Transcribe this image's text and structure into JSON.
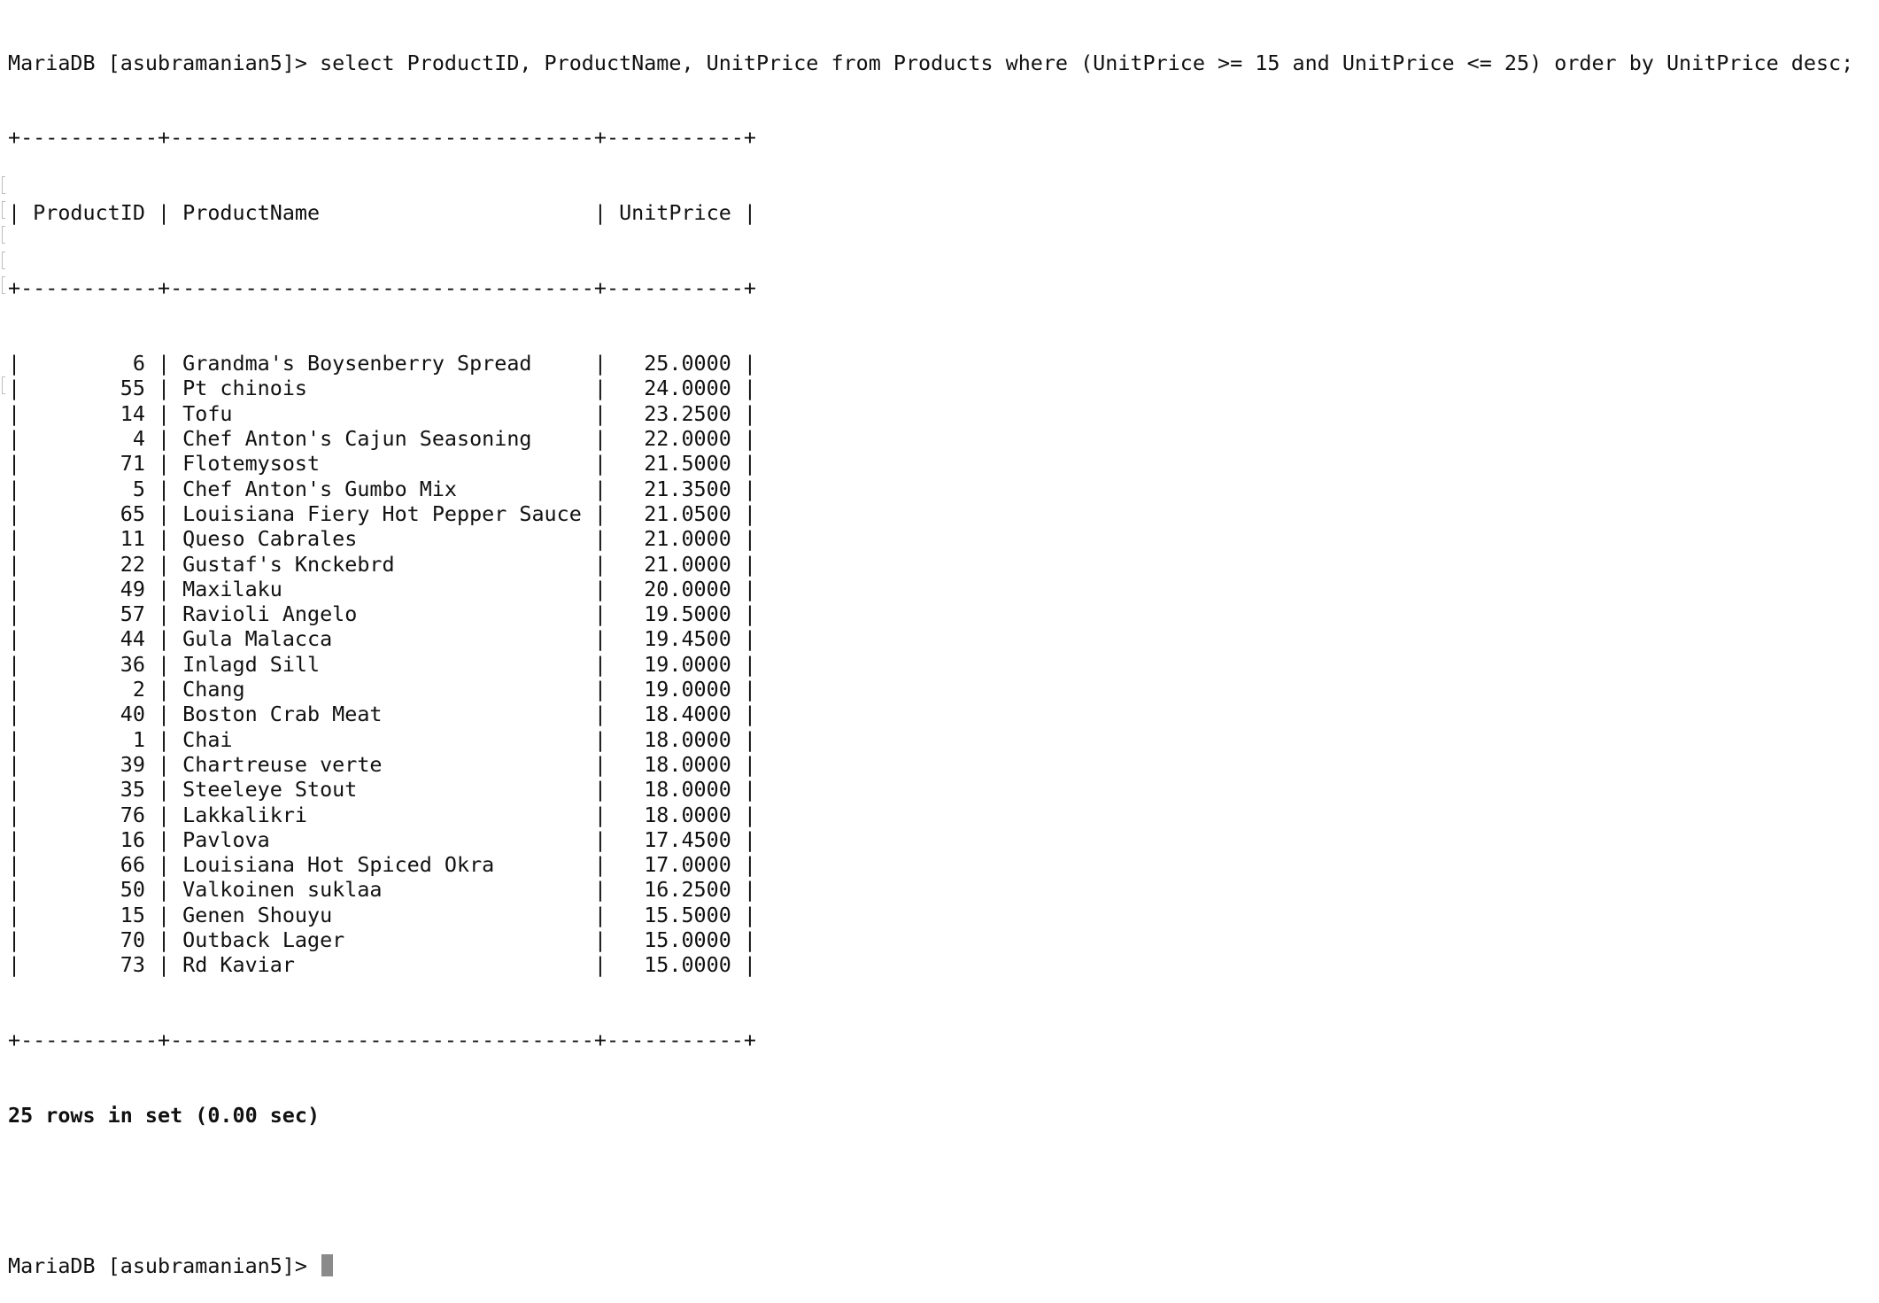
{
  "prompt": "MariaDB [asubramanian5]>",
  "query": "select ProductID, ProductName, UnitPrice from Products where (UnitPrice >= 15 and UnitPrice <= 25) order by UnitPrice desc;",
  "table": {
    "columns": [
      "ProductID",
      "ProductName",
      "UnitPrice"
    ],
    "rows": [
      [
        "6",
        "Grandma's Boysenberry Spread",
        "25.0000"
      ],
      [
        "55",
        "Pt chinois",
        "24.0000"
      ],
      [
        "14",
        "Tofu",
        "23.2500"
      ],
      [
        "4",
        "Chef Anton's Cajun Seasoning",
        "22.0000"
      ],
      [
        "71",
        "Flotemysost",
        "21.5000"
      ],
      [
        "5",
        "Chef Anton's Gumbo Mix",
        "21.3500"
      ],
      [
        "65",
        "Louisiana Fiery Hot Pepper Sauce",
        "21.0500"
      ],
      [
        "11",
        "Queso Cabrales",
        "21.0000"
      ],
      [
        "22",
        "Gustaf's Knckebrd",
        "21.0000"
      ],
      [
        "49",
        "Maxilaku",
        "20.0000"
      ],
      [
        "57",
        "Ravioli Angelo",
        "19.5000"
      ],
      [
        "44",
        "Gula Malacca",
        "19.4500"
      ],
      [
        "36",
        "Inlagd Sill",
        "19.0000"
      ],
      [
        "2",
        "Chang",
        "19.0000"
      ],
      [
        "40",
        "Boston Crab Meat",
        "18.4000"
      ],
      [
        "1",
        "Chai",
        "18.0000"
      ],
      [
        "39",
        "Chartreuse verte",
        "18.0000"
      ],
      [
        "35",
        "Steeleye Stout",
        "18.0000"
      ],
      [
        "76",
        "Lakkalikri",
        "18.0000"
      ],
      [
        "16",
        "Pavlova",
        "17.4500"
      ],
      [
        "66",
        "Louisiana Hot Spiced Okra",
        "17.0000"
      ],
      [
        "50",
        "Valkoinen suklaa",
        "16.2500"
      ],
      [
        "15",
        "Genen Shouyu",
        "15.5000"
      ],
      [
        "70",
        "Outback Lager",
        "15.0000"
      ],
      [
        "73",
        "Rd Kaviar",
        "15.0000"
      ]
    ]
  },
  "result_summary": "25 rows in set (0.00 sec)",
  "colors": {
    "background": "#ffffff",
    "text": "#111111",
    "cursor": "#8a8a8a"
  }
}
